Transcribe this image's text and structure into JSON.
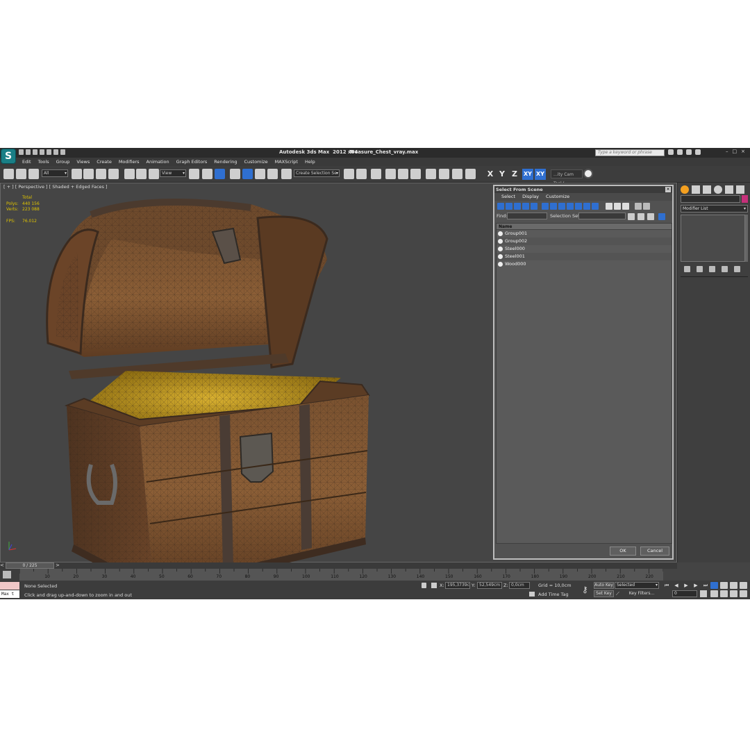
{
  "window": {
    "app_logo": "S",
    "title_app": "Autodesk 3ds Max  2012 x64",
    "title_file": "Treasure_Chest_vray.max",
    "search_placeholder": "Type a keyword or phrase",
    "controls": [
      "–",
      "□",
      "×"
    ]
  },
  "menus": [
    "Edit",
    "Tools",
    "Group",
    "Views",
    "Create",
    "Modifiers",
    "Animation",
    "Graph Editors",
    "Rendering",
    "Customize",
    "MAXScript",
    "Help"
  ],
  "main_toolbar": {
    "selection_filter": "All",
    "ref_coord": "View",
    "named_selection": "Create Selection Se",
    "axis_x": "X",
    "axis_y": "Y",
    "axis_z": "Z",
    "axis_xy": "XY",
    "axis_xy2": "XY",
    "cam_tool": "...ity Cam Tool ("
  },
  "viewport": {
    "label": "[ + ] [ Perspective ] [ Shaded + Edged Faces ]",
    "stats": {
      "header": "Total",
      "polys_label": "Polys:",
      "polys": "440 156",
      "verts_label": "Verts:",
      "verts": "223 088",
      "fps_label": "FPS:",
      "fps": "76.012"
    }
  },
  "dialog": {
    "title": "Select From Scene",
    "menus": [
      "Select",
      "Display",
      "Customize"
    ],
    "find_label": "Find:",
    "selection_set_label": "Selection Set:",
    "column_name": "Name",
    "items": [
      {
        "name": "Group001",
        "icon": "group-icon"
      },
      {
        "name": "Group002",
        "icon": "group-icon"
      },
      {
        "name": "Steel000",
        "icon": "sphere-icon"
      },
      {
        "name": "Steel001",
        "icon": "sphere-icon"
      },
      {
        "name": "Wood000",
        "icon": "sphere-icon"
      }
    ],
    "ok": "OK",
    "cancel": "Cancel"
  },
  "command_panel": {
    "modifier_list": "Modifier List",
    "object_color": "#c6307a"
  },
  "timeline": {
    "frame_display": "0 / 225",
    "prev": "<",
    "next": ">",
    "ticks": [
      "10",
      "20",
      "30",
      "40",
      "50",
      "60",
      "70",
      "80",
      "90",
      "100",
      "110",
      "120",
      "130",
      "140",
      "150",
      "160",
      "170",
      "180",
      "190",
      "200",
      "210",
      "220"
    ]
  },
  "status": {
    "maxscript": "Max t",
    "selection": "None Selected",
    "prompt": "Click and drag up-and-down to zoom in and out",
    "x_label": "X:",
    "x_value": "195,3739c",
    "y_label": "Y:",
    "y_value": "52,549cm",
    "z_label": "Z:",
    "z_value": "0,0cm",
    "grid": "Grid = 10,0cm",
    "add_time_tag": "Add Time Tag",
    "auto_key": "Auto Key",
    "set_key": "Set Key",
    "key_mode": "Selected",
    "key_filters": "Key Filters...",
    "frame": "0"
  },
  "colors": {
    "accent_blue": "#2f6fd0",
    "stats_yellow": "#e0c400",
    "dialog_border": "#bdbdbd"
  }
}
